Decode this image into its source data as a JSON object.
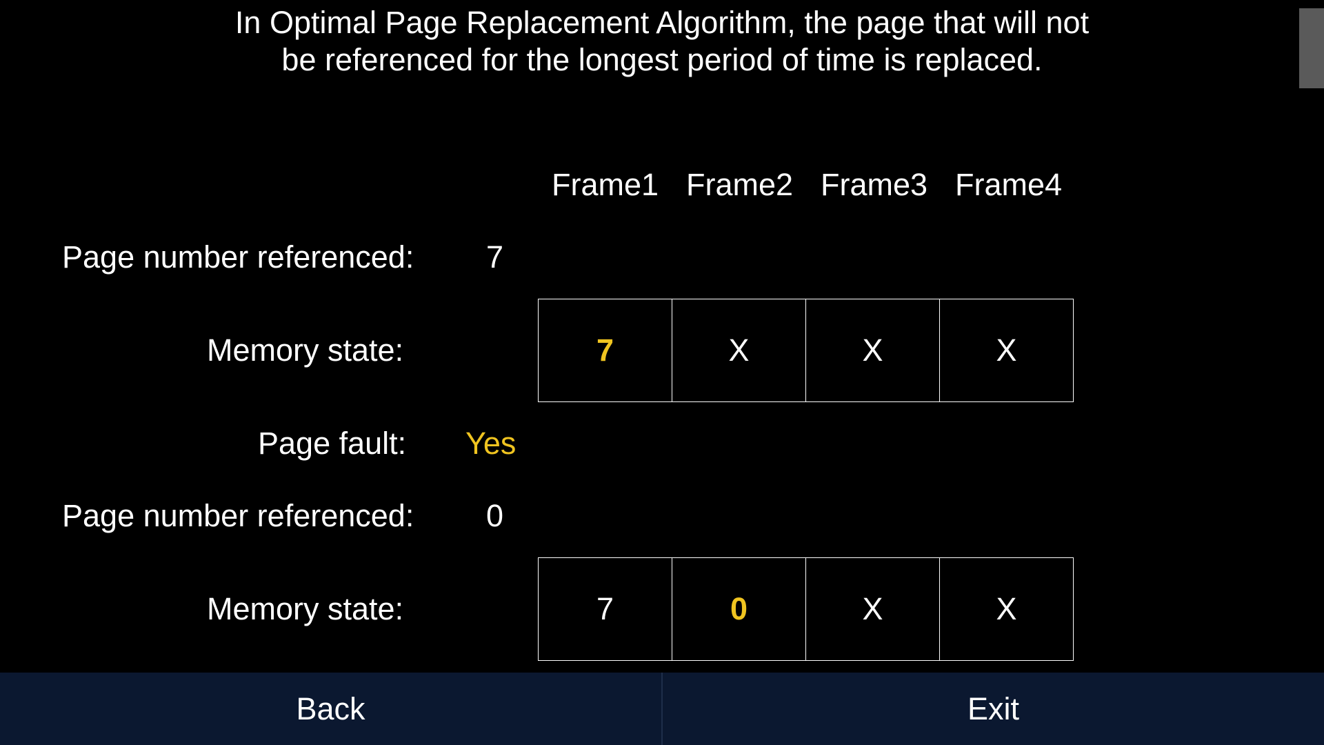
{
  "description": {
    "line1": "In Optimal Page Replacement Algorithm, the page that will not",
    "line2": "be referenced for the longest period of time is replaced."
  },
  "frames": [
    "Frame1",
    "Frame2",
    "Frame3",
    "Frame4"
  ],
  "labels": {
    "page_number_referenced": "Page number referenced:",
    "memory_state": "Memory state:",
    "page_fault": "Page fault:"
  },
  "steps": [
    {
      "page_referenced": "7",
      "memory_state": [
        "7",
        "X",
        "X",
        "X"
      ],
      "highlight_index": 0,
      "page_fault": "Yes"
    },
    {
      "page_referenced": "0",
      "memory_state": [
        "7",
        "0",
        "X",
        "X"
      ],
      "highlight_index": 1
    }
  ],
  "colors": {
    "background": "#000000",
    "highlight": "#f0c420",
    "bottom_bar": "#0b1830"
  },
  "buttons": {
    "back": "Back",
    "exit": "Exit"
  }
}
